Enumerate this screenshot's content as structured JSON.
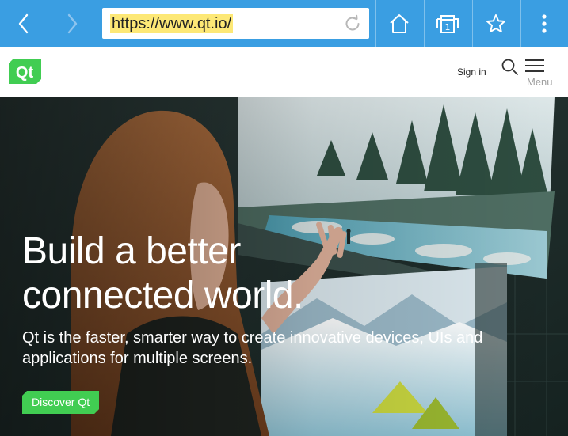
{
  "browser": {
    "url": "https://www.qt.io/",
    "tabs_count": "1",
    "accent_color": "#3a9ee2",
    "url_highlight_color": "#fde876",
    "icons": [
      "back-arrow",
      "forward-arrow",
      "reload",
      "home",
      "tabs",
      "star",
      "more-vertical"
    ]
  },
  "site_header": {
    "logo_text": "Qt",
    "sign_in_label": "Sign in",
    "menu_label": "Menu",
    "brand_color": "#41cd52"
  },
  "hero": {
    "title_line1": "Build a better",
    "title_line2": "connected world.",
    "subtitle_line1": "Qt is the faster, smarter way to create innovative devices, UIs and",
    "subtitle_line2": "applications for multiple screens.",
    "cta_label": "Discover Qt"
  }
}
